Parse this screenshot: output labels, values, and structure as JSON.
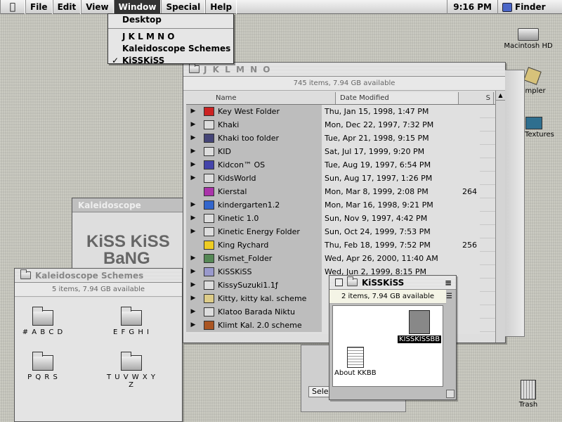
{
  "menubar": {
    "items": [
      "File",
      "Edit",
      "View",
      "Window",
      "Special",
      "Help"
    ],
    "clock": "9:16 PM",
    "app": "Finder"
  },
  "window_menu": {
    "items": [
      "Desktop",
      "J K L M N O",
      "Kaleidoscope Schemes",
      "KiSSKiSS"
    ],
    "checked": "KiSSKiSS"
  },
  "desktop": {
    "hd": "Macintosh HD",
    "sampler": "ampler",
    "textures": "Textures",
    "trash": "Trash"
  },
  "jk_window": {
    "title": "J K L M N O",
    "info": "745 items, 7.94 GB available",
    "columns": [
      "Name",
      "Date Modified",
      "S"
    ],
    "rows": [
      {
        "name": "Key West Folder",
        "date": "Thu, Jan 15, 1998, 1:47 PM",
        "size": "",
        "expand": true,
        "color": "#c22"
      },
      {
        "name": "Khaki",
        "date": "Mon, Dec 22, 1997, 7:32 PM",
        "size": "",
        "expand": true,
        "color": "#ddd"
      },
      {
        "name": "Khaki too folder",
        "date": "Tue, Apr 21, 1998, 9:15 PM",
        "size": "",
        "expand": true,
        "color": "#447"
      },
      {
        "name": "KID",
        "date": "Sat, Jul 17, 1999, 9:20 PM",
        "size": "",
        "expand": true,
        "color": "#ddd"
      },
      {
        "name": "Kidcon™ OS",
        "date": "Tue, Aug 19, 1997, 6:54 PM",
        "size": "",
        "expand": true,
        "color": "#44a"
      },
      {
        "name": "KidsWorld",
        "date": "Sun, Aug 17, 1997, 1:26 PM",
        "size": "",
        "expand": true,
        "color": "#ddd"
      },
      {
        "name": "Kierstal",
        "date": "Mon, Mar 8, 1999, 2:08 PM",
        "size": "264",
        "expand": false,
        "color": "#a3a"
      },
      {
        "name": "kindergarten1.2",
        "date": "Mon, Mar 16, 1998, 9:21 PM",
        "size": "",
        "expand": true,
        "color": "#36c"
      },
      {
        "name": "Kinetic 1.0",
        "date": "Sun, Nov 9, 1997, 4:42 PM",
        "size": "",
        "expand": true,
        "color": "#ddd"
      },
      {
        "name": "Kinetic Energy Folder",
        "date": "Sun, Oct 24, 1999, 7:53 PM",
        "size": "",
        "expand": true,
        "color": "#ddd"
      },
      {
        "name": "King Rychard",
        "date": "Thu, Feb 18, 1999, 7:52 PM",
        "size": "256",
        "expand": false,
        "color": "#ec2"
      },
      {
        "name": "Kismet_Folder",
        "date": "Wed, Apr 26, 2000, 11:40 AM",
        "size": "",
        "expand": true,
        "color": "#585"
      },
      {
        "name": "KiSSKiSS",
        "date": "Wed, Jun 2, 1999, 8:15 PM",
        "size": "",
        "expand": true,
        "color": "#99c"
      },
      {
        "name": "KissySuzuki1.1ƒ",
        "date": "",
        "size": "",
        "expand": true,
        "color": "#ddd"
      },
      {
        "name": "Kitty, kitty   kal. scheme",
        "date": "",
        "size": "",
        "expand": true,
        "color": "#dc8"
      },
      {
        "name": "Klatoo Barada Niktu",
        "date": "",
        "size": "",
        "expand": true,
        "color": "#ddd"
      },
      {
        "name": "Klimt Kal. 2.0 scheme",
        "date": "",
        "size": "",
        "expand": true,
        "color": "#a52"
      }
    ]
  },
  "kal_window": {
    "title": "Kaleidoscope",
    "logo_line1": "KiSS KiSS",
    "logo_line2": "BaNG BaN"
  },
  "scheme_window": {
    "title": "Kaleidoscope Schemes",
    "info": "5 items, 7.94 GB available",
    "items": [
      "# A B C D",
      "E F G H I",
      "P Q R S",
      "T U V W X Y Z"
    ]
  },
  "kiss_window": {
    "title": "KiSSKiSS",
    "info": "2 items, 7.94 GB available",
    "items": [
      "KISSKISSBB",
      "About KKBB"
    ]
  },
  "behind_text": "SelectScheme"
}
